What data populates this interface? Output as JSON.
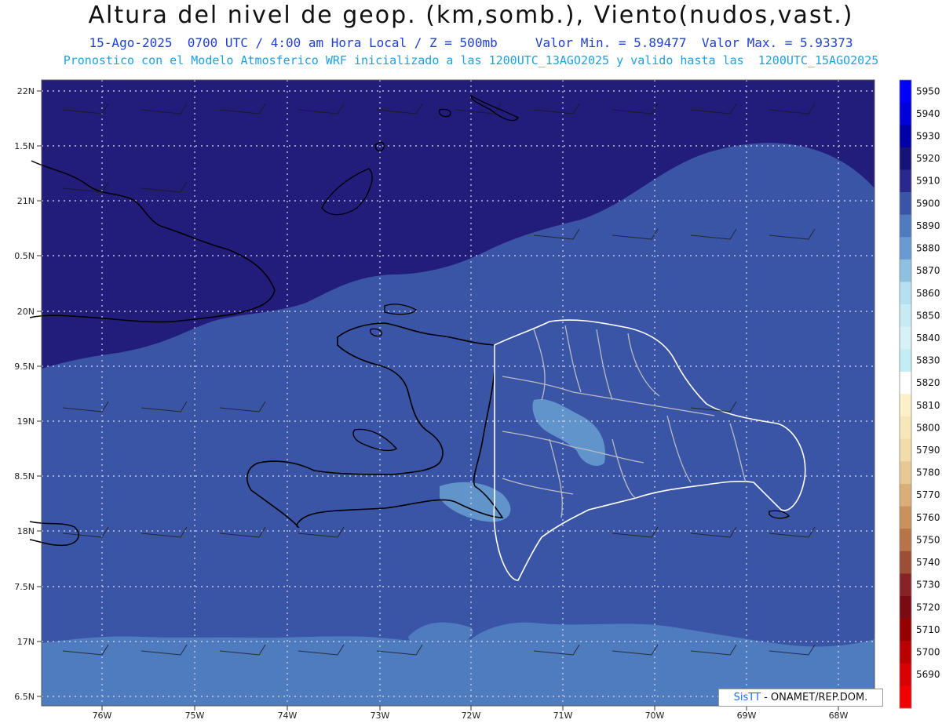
{
  "header": {
    "title": "Altura del nivel de geop. (km,somb.), Viento(nudos,vast.)",
    "date": "15-Ago-2025",
    "time": "0700 UTC / 4:00 am Hora Local / Z = 500mb",
    "valmin": "Valor Min. = 5.89477",
    "valmax": "Valor Max. = 5.93373",
    "model_line": "Pronostico con el Modelo Atmosferico WRF inicializado a las 1200UTC_13AGO2025 y valido hasta las  1200UTC_15AGO2025"
  },
  "map": {
    "lat_labels": [
      "22N",
      "1.5N",
      "21N",
      "0.5N",
      "20N",
      "9.5N",
      "19N",
      "8.5N",
      "18N",
      "7.5N",
      "17N",
      "6.5N"
    ],
    "lon_labels": [
      "76W",
      "75W",
      "74W",
      "73W",
      "72W",
      "71W",
      "70W",
      "69W",
      "68W"
    ],
    "field_colors": {
      "gt5920": "#221c7a",
      "5910_5920": "#2a2f8e",
      "5900_5910": "#3b55a6",
      "5890_5900": "#4f7bbf",
      "5880_5890": "#6294cc"
    }
  },
  "colorbar": {
    "levels": [
      "5950",
      "5940",
      "5930",
      "5920",
      "5910",
      "5900",
      "5890",
      "5880",
      "5870",
      "5860",
      "5850",
      "5840",
      "5830",
      "5820",
      "5810",
      "5800",
      "5790",
      "5780",
      "5770",
      "5760",
      "5750",
      "5740",
      "5730",
      "5720",
      "5710",
      "5700",
      "5690"
    ],
    "colors": [
      "#0000ff",
      "#0000d8",
      "#0000a8",
      "#15137a",
      "#29288c",
      "#3b55a6",
      "#4f7bbf",
      "#6a9bd0",
      "#8fc0e0",
      "#b6dff0",
      "#c8ebf3",
      "#d8f1f7",
      "#c4ecf4",
      "#ffffff",
      "#fbf0c8",
      "#f6e6b8",
      "#f1dcaa",
      "#e8c996",
      "#d9ae78",
      "#c9925d",
      "#b67448",
      "#9b4f34",
      "#872227",
      "#7a0a14",
      "#970000",
      "#bb0000",
      "#d80000",
      "#f00000"
    ]
  },
  "credit": {
    "brand": "SisTT",
    "org": " - ONAMET/REP.DOM."
  }
}
